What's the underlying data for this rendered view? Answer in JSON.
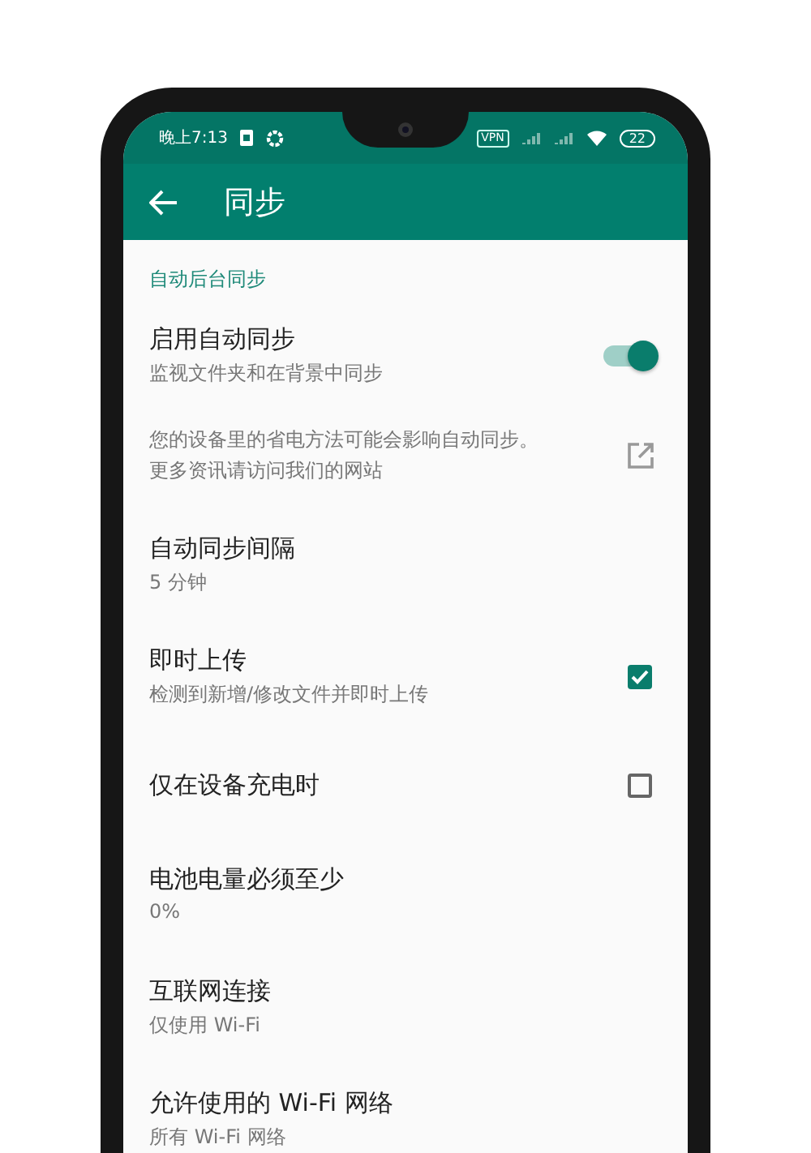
{
  "status_bar": {
    "time": "晚上7:13",
    "vpn": "VPN",
    "battery": "22"
  },
  "app_bar": {
    "title": "同步"
  },
  "section": {
    "title": "自动后台同步"
  },
  "items": [
    {
      "kind": "switch",
      "title": "启用自动同步",
      "subtitle": "监视文件夹和在背景中同步",
      "on": true
    },
    {
      "kind": "link",
      "note": "您的设备里的省电方法可能会影响自动同步。更多资讯请访问我们的网站"
    },
    {
      "kind": "plain",
      "title": "自动同步间隔",
      "subtitle": "5 分钟"
    },
    {
      "kind": "checkbox",
      "title": "即时上传",
      "subtitle": "检测到新增/修改文件并即时上传",
      "checked": true
    },
    {
      "kind": "checkbox",
      "title": "仅在设备充电时",
      "checked": false
    },
    {
      "kind": "plain",
      "title": "电池电量必须至少",
      "subtitle": "0%"
    },
    {
      "kind": "plain",
      "title": "互联网连接",
      "subtitle": "仅使用 Wi-Fi"
    },
    {
      "kind": "plain",
      "title": "允许使用的 Wi-Fi 网络",
      "subtitle": "所有 Wi-Fi 网络"
    }
  ]
}
